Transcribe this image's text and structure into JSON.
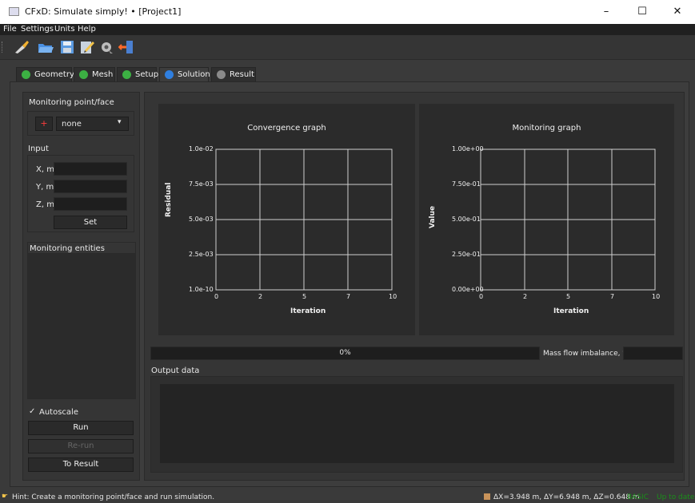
{
  "window": {
    "title": "CFxD: Simulate simply! • [Project1]",
    "minimize": "–",
    "maximize": "☐",
    "close": "✕"
  },
  "menu": [
    "File",
    "Settings",
    "Units",
    "Help"
  ],
  "toolbar": [
    "broom-icon",
    "open-folder-icon",
    "save-icon",
    "edit-notes-icon",
    "gear-person-icon",
    "exit-door-icon"
  ],
  "tabs": [
    {
      "label": "Geometry",
      "status": "done"
    },
    {
      "label": "Mesh",
      "status": "done"
    },
    {
      "label": "Setup",
      "status": "done"
    },
    {
      "label": "Solution",
      "status": "active"
    },
    {
      "label": "Result",
      "status": "pending"
    }
  ],
  "left": {
    "monitoring_title": "Monitoring point/face",
    "dropdown_value": "none",
    "input_title": "Input",
    "x_label": "X, m",
    "y_label": "Y, m",
    "z_label": "Z, m",
    "set_button": "Set",
    "entities_title": "Monitoring entities",
    "autoscale_label": "Autoscale",
    "run_button": "Run",
    "rerun_button": "Re-run",
    "to_result_button": "To Result"
  },
  "graphs": {
    "convergence": {
      "title": "Convergence graph",
      "ylabel": "Residual",
      "xlabel": "Iteration",
      "yticks": [
        "1.0e-02",
        "7.5e-03",
        "5.0e-03",
        "2.5e-03",
        "1.0e-10"
      ],
      "xticks": [
        "0",
        "2",
        "5",
        "7",
        "10"
      ]
    },
    "monitoring": {
      "title": "Monitoring graph",
      "ylabel": "Value",
      "xlabel": "Iteration",
      "yticks": [
        "1.00e+00",
        "7.50e-01",
        "5.00e-01",
        "2.50e-01",
        "0.00e+00"
      ],
      "xticks": [
        "0",
        "2",
        "5",
        "7",
        "10"
      ]
    }
  },
  "progress": {
    "text": "0%",
    "value": 0
  },
  "mass_flow_label": "Mass flow imbalance, %",
  "output_label": "Output data",
  "status": {
    "hint": "Hint: Create a monitoring point/face and run simulation.",
    "dims": "ΔX=3.948 m, ΔY=6.948 m, ΔZ=0.648 m",
    "mode": "BASIC",
    "state": "Up to date"
  },
  "colors": {
    "done": "#3cb043",
    "active": "#2f7fe0",
    "pending": "#8a8a8a",
    "status_green": "#1a8f1a"
  }
}
